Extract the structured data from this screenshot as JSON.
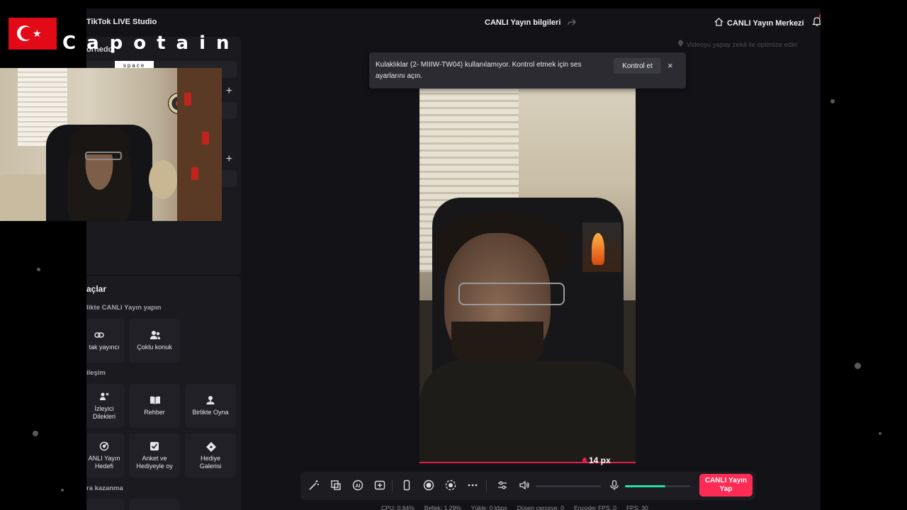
{
  "app": {
    "title": "TikTok LIVE Studio",
    "stream_info_label": "CANLI Yayın bilgileri",
    "live_center_label": "CANLI Yayın Merkezi"
  },
  "scene_panel": {
    "title": "örnedo"
  },
  "notification": {
    "message": "Kulaklıklar (2- MIIIW-TW04) kullanılamıyor. Kontrol etmek için ses ayarlarını açın.",
    "action_label": "Kontrol et",
    "close_glyph": "×"
  },
  "ai_hint": "Videoyu yapay zekâ ile optimize edin",
  "tools": {
    "title": "açlar",
    "sections": {
      "together": "likte CANLI Yayın yapın",
      "interaction": "ileşim",
      "earn": "ra kazanma"
    },
    "items": {
      "co_host": "tak yayıncı",
      "multi_guest": "Çoklu konuk",
      "viewer_wishes": "İzleyici\nDilekleri",
      "guide": "Rehber",
      "play_together": "Birlikte Oyna",
      "live_goal": "ANLI Yayın\nHedefi",
      "poll": "Anket ve\nHediyeyle oy",
      "gift_gallery": "Hediye\nGalerisi"
    }
  },
  "preview": {
    "marker_label": "14 px"
  },
  "toolbar": {
    "go_live_label": "CANLI Yayın\nYap",
    "mic_level": 0.62,
    "volume_level": 0
  },
  "status": {
    "cpu": "CPU: 0.84%",
    "memory": "Bellek: 1.29%",
    "upload": "Yükle: 0 kbps",
    "dropped": "Düşen çerçeve: 0",
    "encoder_fps": "Encoder FPS: 0",
    "fps": "FPS: 30"
  },
  "overlay": {
    "brand": "Capotain",
    "brand_sub": "space"
  },
  "colors": {
    "accent": "#fe2c55",
    "mic_level": "#25e0a5",
    "panel": "#1a1a1f",
    "background": "#131317"
  }
}
